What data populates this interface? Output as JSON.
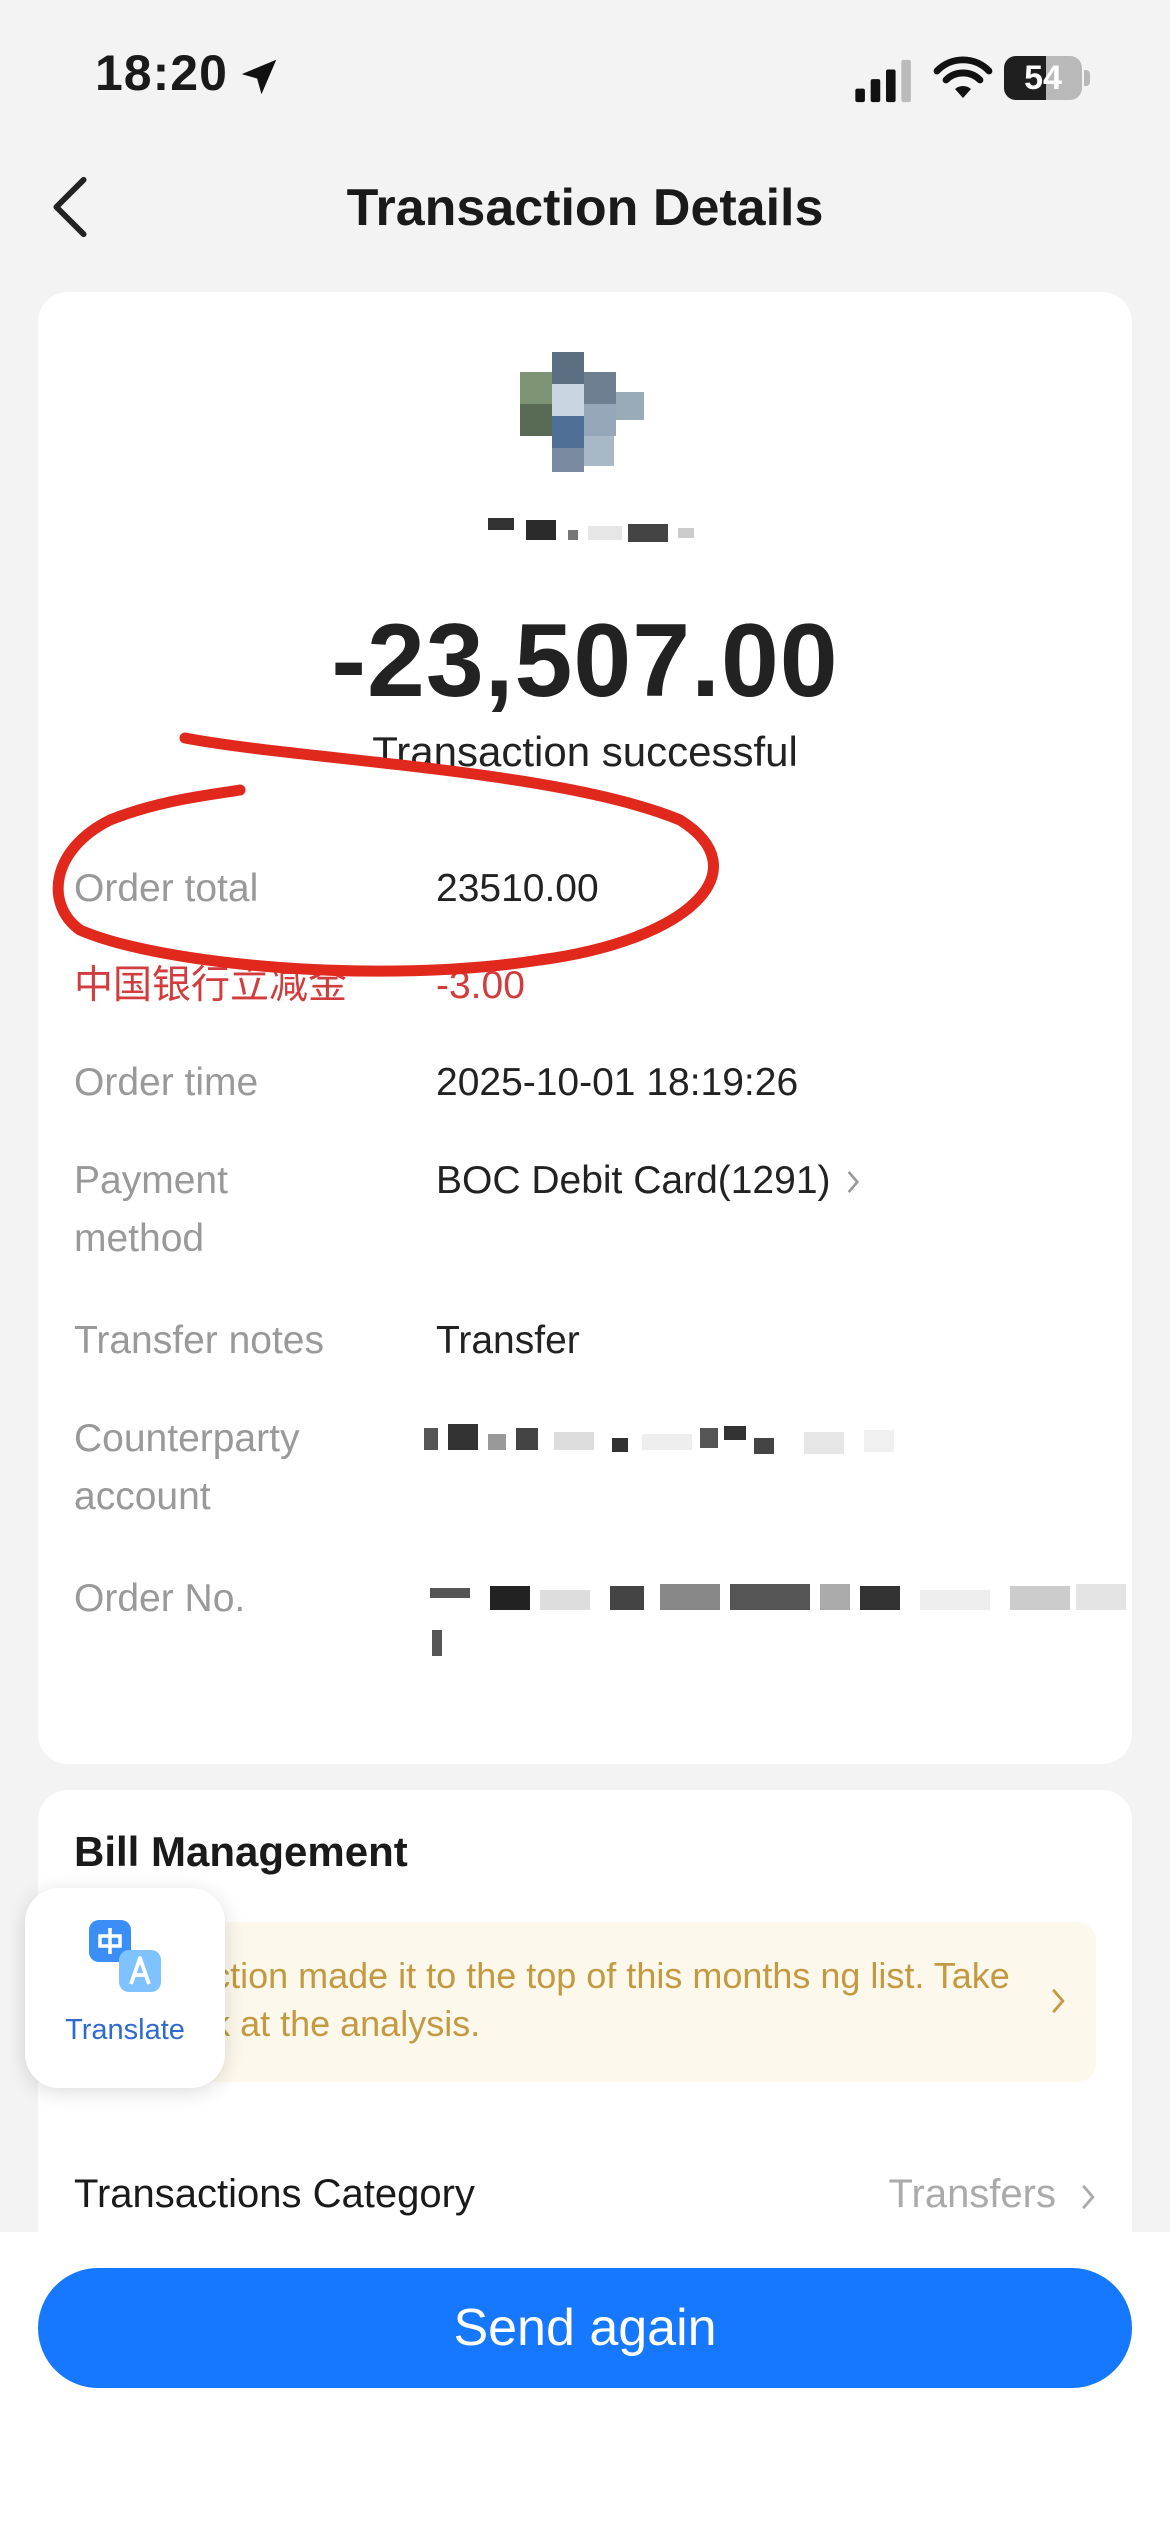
{
  "status_bar": {
    "time": "18:20",
    "battery": "54",
    "battery_level": 0.54
  },
  "nav": {
    "title": "Transaction Details"
  },
  "summary": {
    "amount": "-23,507.00",
    "status": "Transaction successful"
  },
  "details": [
    {
      "label": "Order total",
      "value": "23510.00"
    },
    {
      "label": "中国银行立减金",
      "value": "-3.00"
    },
    {
      "label": "Order time",
      "value": "2025-10-01 18:19:26"
    },
    {
      "label": "Payment method",
      "value": "BOC Debit Card(1291)"
    },
    {
      "label": "Transfer notes",
      "value": "Transfer"
    },
    {
      "label": "Counterparty account",
      "value": ""
    },
    {
      "label": "Order No.",
      "value": ""
    }
  ],
  "bill": {
    "title": "Bill Management",
    "banner_text": "ansaction made it to the top of this months ng list. Take a look at the analysis.",
    "category_label": "Transactions Category",
    "category_value": "Transfers"
  },
  "translate": {
    "label": "Translate"
  },
  "actions": {
    "send_again": "Send again"
  },
  "colors": {
    "primary": "#1677ff",
    "discount_red": "#d23c3c",
    "annotation_red": "#e0281c",
    "banner_text": "#c39a42"
  },
  "icons": [
    "location-arrow-icon",
    "signal-icon",
    "wifi-icon",
    "battery-icon",
    "back-chevron-icon",
    "chevron-right-icon",
    "translate-icon"
  ]
}
